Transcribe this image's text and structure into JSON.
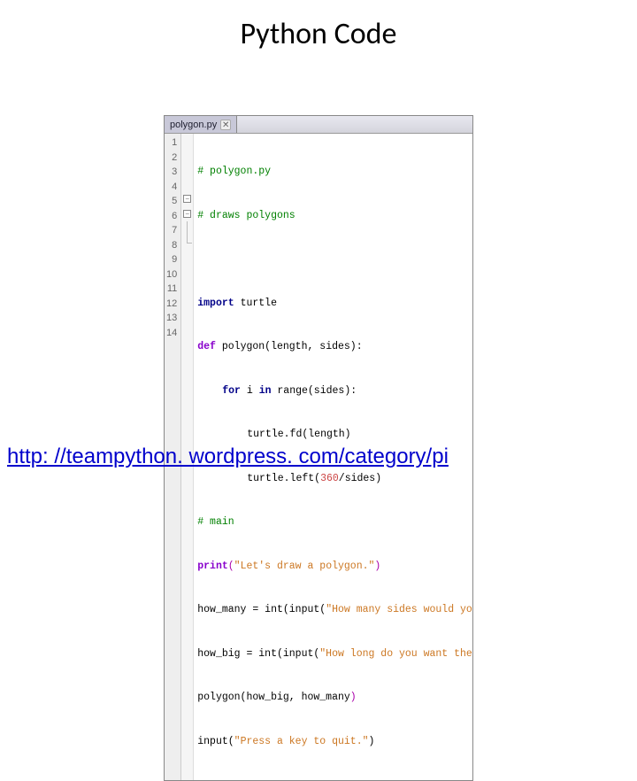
{
  "title": "Python Code",
  "tab": {
    "filename": "polygon.py",
    "close": "✕"
  },
  "lines": {
    "n1": "1",
    "n2": "2",
    "n3": "3",
    "n4": "4",
    "n5": "5",
    "n6": "6",
    "n7": "7",
    "n8": "8",
    "n9": "9",
    "n10": "10",
    "n11": "11",
    "n12": "12",
    "n13": "13",
    "n14": "14"
  },
  "fold": {
    "minus": "−"
  },
  "code": {
    "l1": "# polygon.py",
    "l2": "# draws polygons",
    "l3": "",
    "l4_kw": "import",
    "l4_rest": " turtle",
    "l5_kw": "def",
    "l5_rest": " polygon(length, sides):",
    "l6_kw": "for",
    "l6_mid": " i ",
    "l6_kw2": "in",
    "l6_rest": " range(sides):",
    "l7": "turtle.fd(length)",
    "l8a": "turtle.left(",
    "l8num": "360",
    "l8b": "/sides)",
    "l9": "# main",
    "l10_kw": "print",
    "l10_p1": "(",
    "l10_str": "\"Let's draw a polygon.\"",
    "l10_p2": ")",
    "l11a": "how_many = int(input(",
    "l11_str": "\"How many sides would you like?\"",
    "l11b": "))",
    "l12a": "how_big = int(input(",
    "l12_str": "\"How long do you want the sides?\"",
    "l12b": "))",
    "l13a": "polygon(how_big, how_many",
    "l13b": ")",
    "l14a": "input(",
    "l14_str": "\"Press a key to quit.\"",
    "l14b": ")"
  },
  "link": "http: //teampython. wordpress. com/category/pi"
}
